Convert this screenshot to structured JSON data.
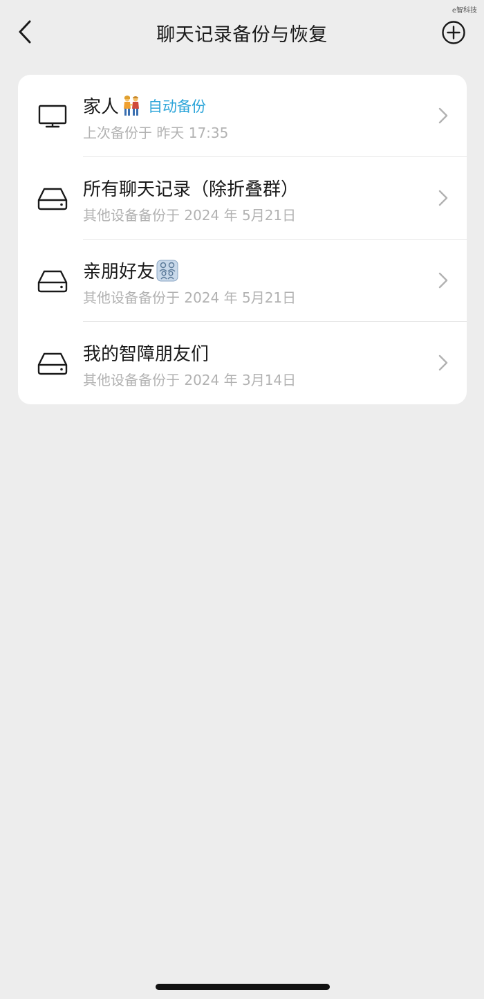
{
  "watermark": "e智科技",
  "nav": {
    "title": "聊天记录备份与恢复"
  },
  "backups": [
    {
      "icon": "monitor-icon",
      "name": "家人",
      "emoji": "couple-emoji",
      "tag": "自动备份",
      "subtitle": "上次备份于 昨天 17:35"
    },
    {
      "icon": "hard-drive-icon",
      "name": "所有聊天记录（除折叠群）",
      "subtitle": "其他设备备份于 2024 年 5月21日"
    },
    {
      "icon": "hard-drive-icon",
      "name": "亲朋好友",
      "emoji": "family-emoji",
      "subtitle": "其他设备备份于 2024 年 5月21日"
    },
    {
      "icon": "hard-drive-icon",
      "name": "我的智障朋友们",
      "subtitle": "其他设备备份于 2024 年 3月14日"
    }
  ],
  "colors": {
    "background": "#ededed",
    "card": "#ffffff",
    "accent": "#2ca5d9",
    "title_text": "#191919",
    "subtitle_text": "#b2b2b2"
  }
}
